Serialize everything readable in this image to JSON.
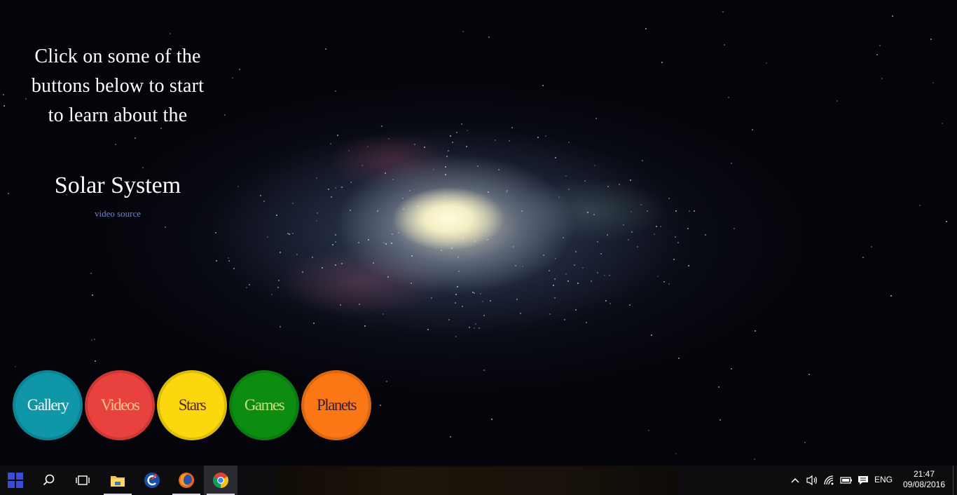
{
  "intro": {
    "line1": "Click on some of the",
    "line2": "buttons below to start",
    "line3": "to learn about the",
    "title": "Solar System",
    "video_source": "video source"
  },
  "buttons": [
    {
      "label": "Gallery",
      "bg": "#0f97a8",
      "fg": "#f2f6f8"
    },
    {
      "label": "Videos",
      "bg": "#e9413d",
      "fg": "#f6c48a"
    },
    {
      "label": "Stars",
      "bg": "#fbd80d",
      "fg": "#5a2a2a"
    },
    {
      "label": "Games",
      "bg": "#0d8c12",
      "fg": "#c9e07a"
    },
    {
      "label": "Planets",
      "bg": "#fb7614",
      "fg": "#3a1f3a"
    }
  ],
  "taskbar": {
    "apps": [
      "search-icon",
      "task-view-icon",
      "file-explorer-icon",
      "ccleaner-icon",
      "firefox-icon",
      "chrome-icon"
    ],
    "language": "ENG",
    "time": "21:47",
    "date": "09/08/2016"
  },
  "colors": {
    "title_text": "#ffffff",
    "link": "#6e86c8",
    "taskbar": "#0d0d10"
  }
}
